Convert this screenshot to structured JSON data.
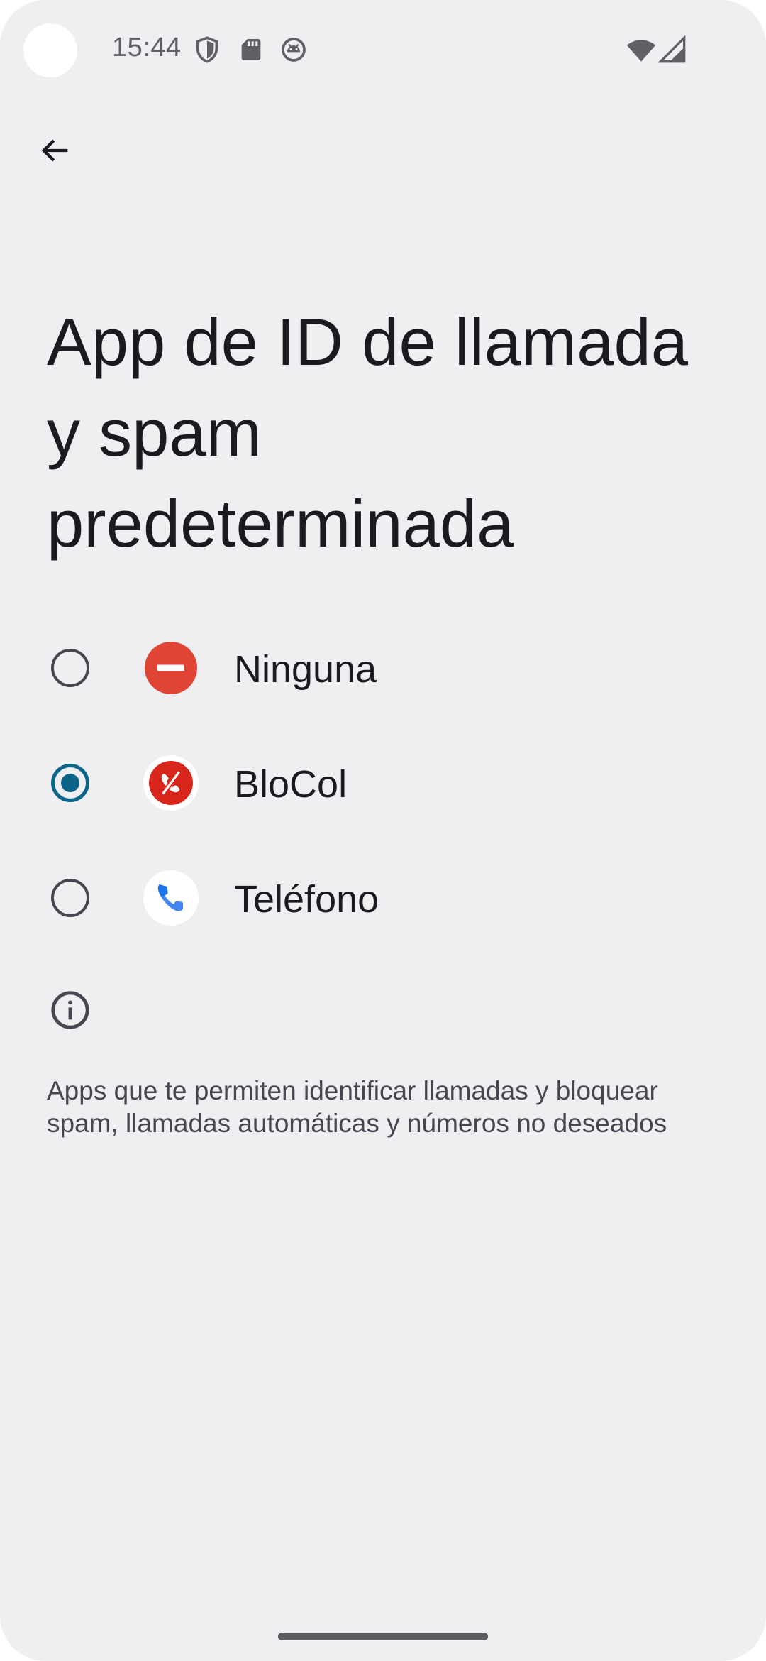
{
  "status_bar": {
    "time": "15:44",
    "icons": [
      "shield-icon",
      "sd-card-icon",
      "android-debug-icon",
      "wifi-icon",
      "signal-icon"
    ]
  },
  "nav": {
    "back_icon": "arrow-back-icon"
  },
  "page": {
    "title": "App de ID de llamada y spam predeterminada"
  },
  "options": [
    {
      "label": "Ninguna",
      "icon": "none-icon",
      "selected": false
    },
    {
      "label": "BloCol",
      "icon": "blocol-app-icon",
      "selected": true
    },
    {
      "label": "Teléfono",
      "icon": "phone-app-icon",
      "selected": false
    }
  ],
  "info": {
    "icon": "info-icon",
    "text": "Apps que te permiten identificar llamadas y bloquear spam, llamadas automáticas y números no deseados"
  },
  "colors": {
    "background": "#efeff2",
    "accent": "#0b6589",
    "text_primary": "#1b1b1f",
    "text_secondary": "#45464f",
    "none_red": "#e04434",
    "blocol_red": "#d9261c",
    "phone_blue": "#1a73e8"
  }
}
